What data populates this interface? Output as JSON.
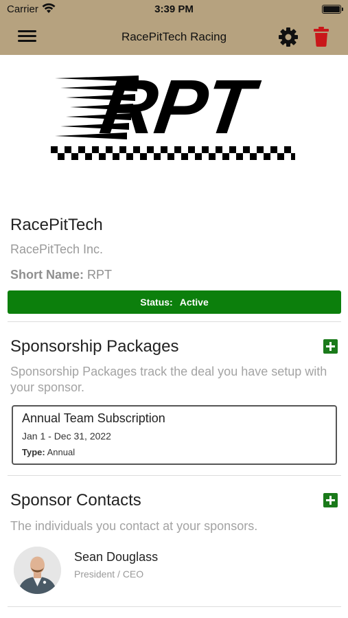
{
  "status_bar": {
    "carrier": "Carrier",
    "time": "3:39 PM"
  },
  "nav": {
    "title": "RacePitTech Racing",
    "menu_icon": "hamburger-menu-icon",
    "settings_icon": "gear-icon",
    "delete_icon": "trash-icon"
  },
  "logo": {
    "text": "RPT"
  },
  "sponsor": {
    "name": "RacePitTech",
    "legal_name": "RacePitTech Inc.",
    "short_name_label": "Short Name:",
    "short_name": "RPT",
    "status_label": "Status:",
    "status_value": "Active"
  },
  "packages": {
    "title": "Sponsorship Packages",
    "description": "Sponsorship Packages track the deal you have setup with your sponsor.",
    "items": [
      {
        "name": "Annual Team Subscription",
        "dates": "Jan 1 - Dec 31, 2022",
        "type_label": "Type:",
        "type": "Annual"
      }
    ]
  },
  "contacts": {
    "title": "Sponsor Contacts",
    "description": "The individuals you contact at your sponsors.",
    "items": [
      {
        "name": "Sean Douglass",
        "role": "President / CEO"
      }
    ]
  },
  "colors": {
    "nav_background": "#b6a27f",
    "status_green": "#0c7f0c",
    "add_green": "#1a7a1a",
    "delete_red": "#c9171a"
  }
}
